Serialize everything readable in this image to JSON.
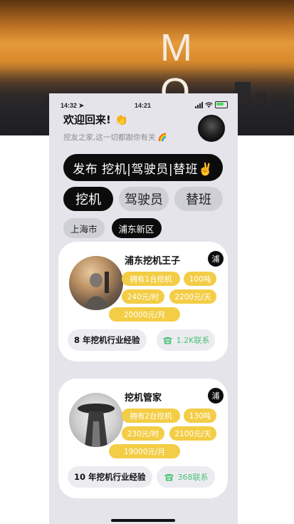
{
  "banner": {
    "text": "M O"
  },
  "status_bar": {
    "time_left": "14:32",
    "time_center": "14:21"
  },
  "header": {
    "welcome": "欢迎回来! 👏",
    "subtitle": "挖友之家,这一切都跟你有关 🌈"
  },
  "publish_button": {
    "label": "发布 挖机|驾驶员|替班✌️"
  },
  "category_tabs": [
    {
      "label": "挖机",
      "active": true
    },
    {
      "label": "驾驶员",
      "active": false
    },
    {
      "label": "替班",
      "active": false
    }
  ],
  "location_tabs": [
    {
      "label": "上海市",
      "active": false
    },
    {
      "label": "浦东新区",
      "active": true
    }
  ],
  "cards": [
    {
      "name": "浦东挖机王子",
      "region": "浦",
      "tags": [
        "拥有1台挖机",
        "100吨",
        "240元/时",
        "2200元/天",
        "20000元/月"
      ],
      "experience": "8 年挖机行业经验",
      "contact": "1.2K联系"
    },
    {
      "name": "挖机管家",
      "region": "浦",
      "tags": [
        "拥有2台挖机",
        "130吨",
        "230元/时",
        "2100元/天",
        "19000元/月"
      ],
      "experience": "10 年挖机行业经验",
      "contact": "368联系"
    }
  ],
  "colors": {
    "accent_yellow": "#f3cd45",
    "contact_green": "#4ec27a",
    "dark": "#0c0c0c"
  },
  "icons": [
    "location-arrow-icon",
    "signal-icon",
    "wifi-icon",
    "battery-icon",
    "phone-icon"
  ]
}
